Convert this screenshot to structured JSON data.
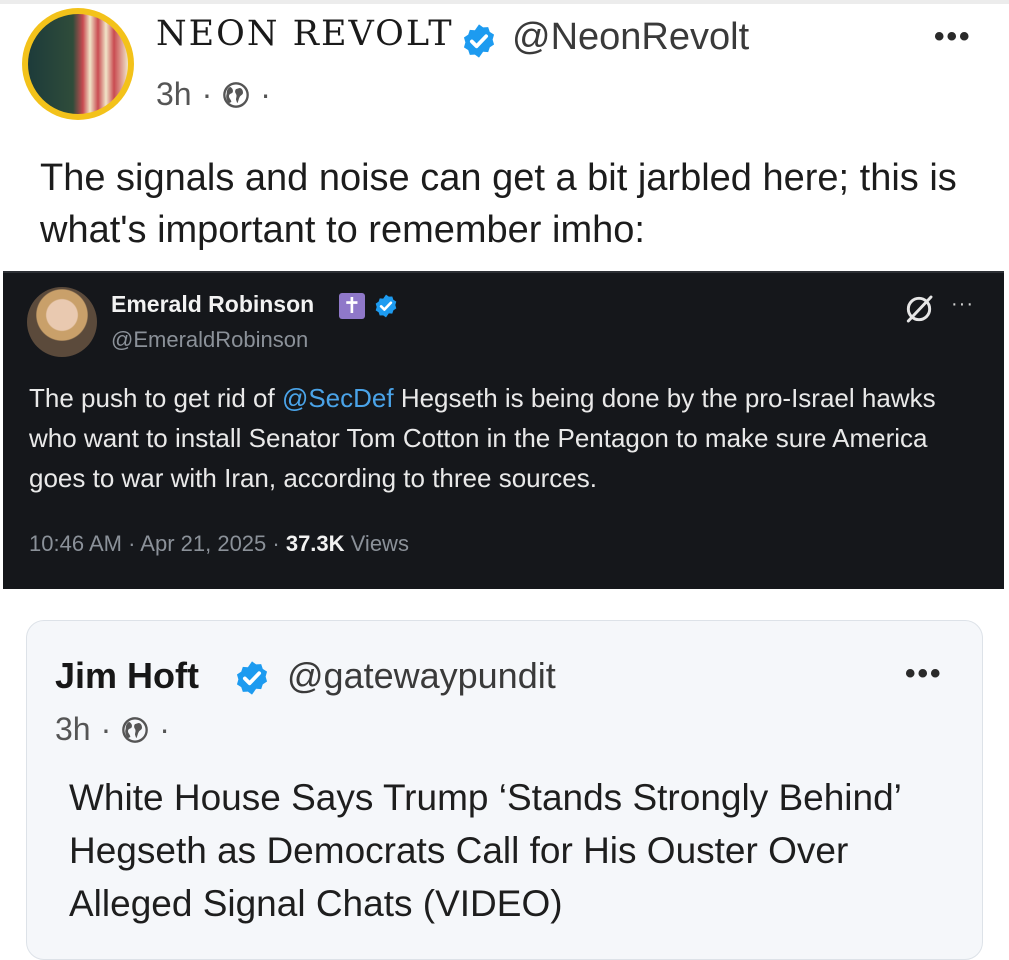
{
  "post": {
    "display_name": "NEON REVOLT",
    "handle": "@NeonRevolt",
    "time": "3h",
    "separator": "·",
    "more": "•••",
    "text": "The signals and noise can get a bit jarbled here; this is what's important to remember imho:"
  },
  "embedded_tweet": {
    "name": "Emerald Robinson",
    "cross_badge": "✝",
    "handle": "@EmeraldRobinson",
    "more": "···",
    "text_before": "The push to get rid of ",
    "mention": "@SecDef",
    "text_after": " Hegseth is being done by the pro-Israel hawks who want to install Senator Tom Cotton in the Pentagon to make sure America goes to war with Iran, according to three sources.",
    "timestamp": "10:46 AM · Apr 21, 2025 · ",
    "views_count": "37.3K",
    "views_label": " Views"
  },
  "quoted_post": {
    "name": "Jim Hoft",
    "handle": "@gatewaypundit",
    "time": "3h",
    "separator": "·",
    "more": "•••",
    "text": "White House Says Trump ‘Stands Strongly Behind’ Hegseth as Democrats Call for His Ouster Over Alleged Signal Chats (VIDEO)"
  },
  "colors": {
    "verified": "#1d9bf0",
    "mention": "#4aa3e8",
    "embed_bg": "#15171b",
    "avatar_ring": "#f3c21a"
  }
}
